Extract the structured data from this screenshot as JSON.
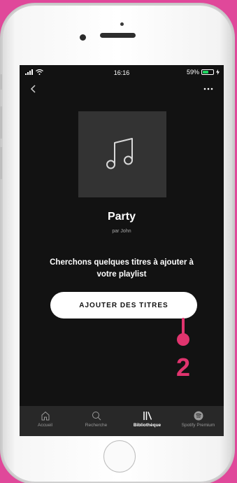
{
  "status_bar": {
    "time": "16:16",
    "battery_percent": "59%",
    "battery_level": 0.59
  },
  "playlist": {
    "title": "Party",
    "byline": "par John",
    "cover_icon": "music-note-icon"
  },
  "prompt_text": "Cherchons quelques titres à ajouter à votre playlist",
  "add_button_label": "AJOUTER DES TITRES",
  "annotation": {
    "number": "2",
    "color": "#e0346e"
  },
  "tabs": [
    {
      "label": "Accueil",
      "icon": "home-icon",
      "active": false
    },
    {
      "label": "Recherche",
      "icon": "search-icon",
      "active": false
    },
    {
      "label": "Bibliothèque",
      "icon": "library-icon",
      "active": true
    },
    {
      "label": "Spotify Premium",
      "icon": "spotify-icon",
      "active": false
    }
  ],
  "colors": {
    "background": "#e0489a",
    "screen": "#121212",
    "tabbar": "#282828",
    "accent": "#1ed760"
  }
}
